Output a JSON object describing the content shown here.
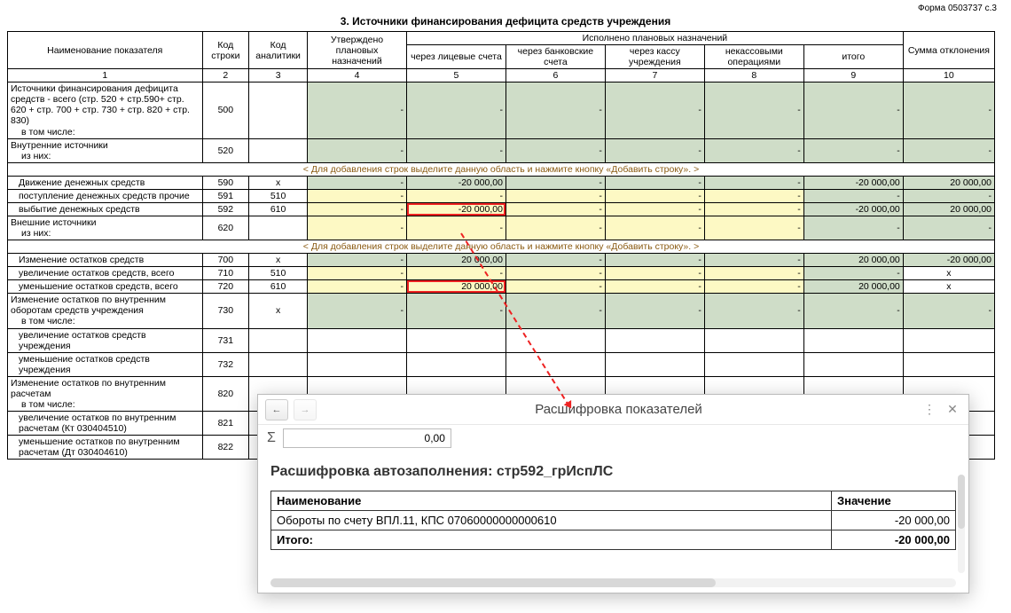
{
  "form_code": "Форма 0503737  с.3",
  "section_title": "3. Источники финансирования дефицита средств учреждения",
  "headers": {
    "name": "Наименование показателя",
    "line_code": "Код строки",
    "analytics_code": "Код аналитики",
    "approved": "Утверждено плановых назначений",
    "executed_group": "Исполнено плановых назначений",
    "col5": "через лицевые счета",
    "col6": "через банковские счета",
    "col7": "через кассу учреждения",
    "col8": "некассовыми операциями",
    "col9": "итого",
    "col10": "Сумма отклонения",
    "nums": [
      "1",
      "2",
      "3",
      "4",
      "5",
      "6",
      "7",
      "8",
      "9",
      "10"
    ]
  },
  "add_row_hint": "< Для добавления строк выделите данную область и нажмите кнопку «Добавить строку». >",
  "dash": "-",
  "x_mark": "x",
  "rows": {
    "r500": {
      "name": "Источники финансирования дефицита средств - всего (стр. 520 + стр.590+ стр. 620 + стр. 700 + стр. 730 + стр. 820 + стр. 830)",
      "sub": "в том числе:",
      "code": "500"
    },
    "r520": {
      "name": "Внутренние источники",
      "sub": "из них:",
      "code": "520"
    },
    "r590": {
      "name": "Движение денежных средств",
      "code": "590",
      "an": "x",
      "c5": "-20 000,00",
      "c9": "-20 000,00",
      "c10": "20 000,00"
    },
    "r591": {
      "name": "поступление денежных средств прочие",
      "code": "591",
      "an": "510"
    },
    "r592": {
      "name": "выбытие денежных средств",
      "code": "592",
      "an": "610",
      "c5": "-20 000,00",
      "c9": "-20 000,00",
      "c10": "20 000,00"
    },
    "r620": {
      "name": "Внешние источники",
      "sub": "из них:",
      "code": "620"
    },
    "r700": {
      "name": "Изменение остатков средств",
      "code": "700",
      "an": "x",
      "c5": "20 000,00",
      "c9": "20 000,00",
      "c10": "-20 000,00"
    },
    "r710": {
      "name": "увеличение остатков средств, всего",
      "code": "710",
      "an": "510",
      "c10": "x"
    },
    "r720": {
      "name": "уменьшение остатков средств, всего",
      "code": "720",
      "an": "610",
      "c5": "20 000,00",
      "c9": "20 000,00",
      "c10": "x"
    },
    "r730": {
      "name": "Изменение остатков по внутренним оборотам средств учреждения",
      "sub": "в том числе:",
      "code": "730",
      "an": "x"
    },
    "r731": {
      "name": "увеличение остатков средств учреждения",
      "code": "731"
    },
    "r732": {
      "name": "уменьшение остатков средств учреждения",
      "code": "732"
    },
    "r820": {
      "name": "Изменение остатков по внутренним расчетам",
      "sub": "в том числе:",
      "code": "820"
    },
    "r821": {
      "name": "увеличение остатков по внутренним расчетам (Кт 030404510)",
      "code": "821"
    },
    "r822": {
      "name": "уменьшение остатков по внутренним расчетам (Дт 030404610)",
      "code": "822"
    }
  },
  "popup": {
    "title": "Расшифровка показателей",
    "sum_value": "0,00",
    "detail_title": "Расшифровка автозаполнения: стр592_грИспЛС",
    "col_name": "Наименование",
    "col_value": "Значение",
    "item_name": "Обороты по счету ВПЛ.11, КПС 07060000000000610",
    "item_value": "-20 000,00",
    "total_label": "Итого:",
    "total_value": "-20 000,00"
  }
}
